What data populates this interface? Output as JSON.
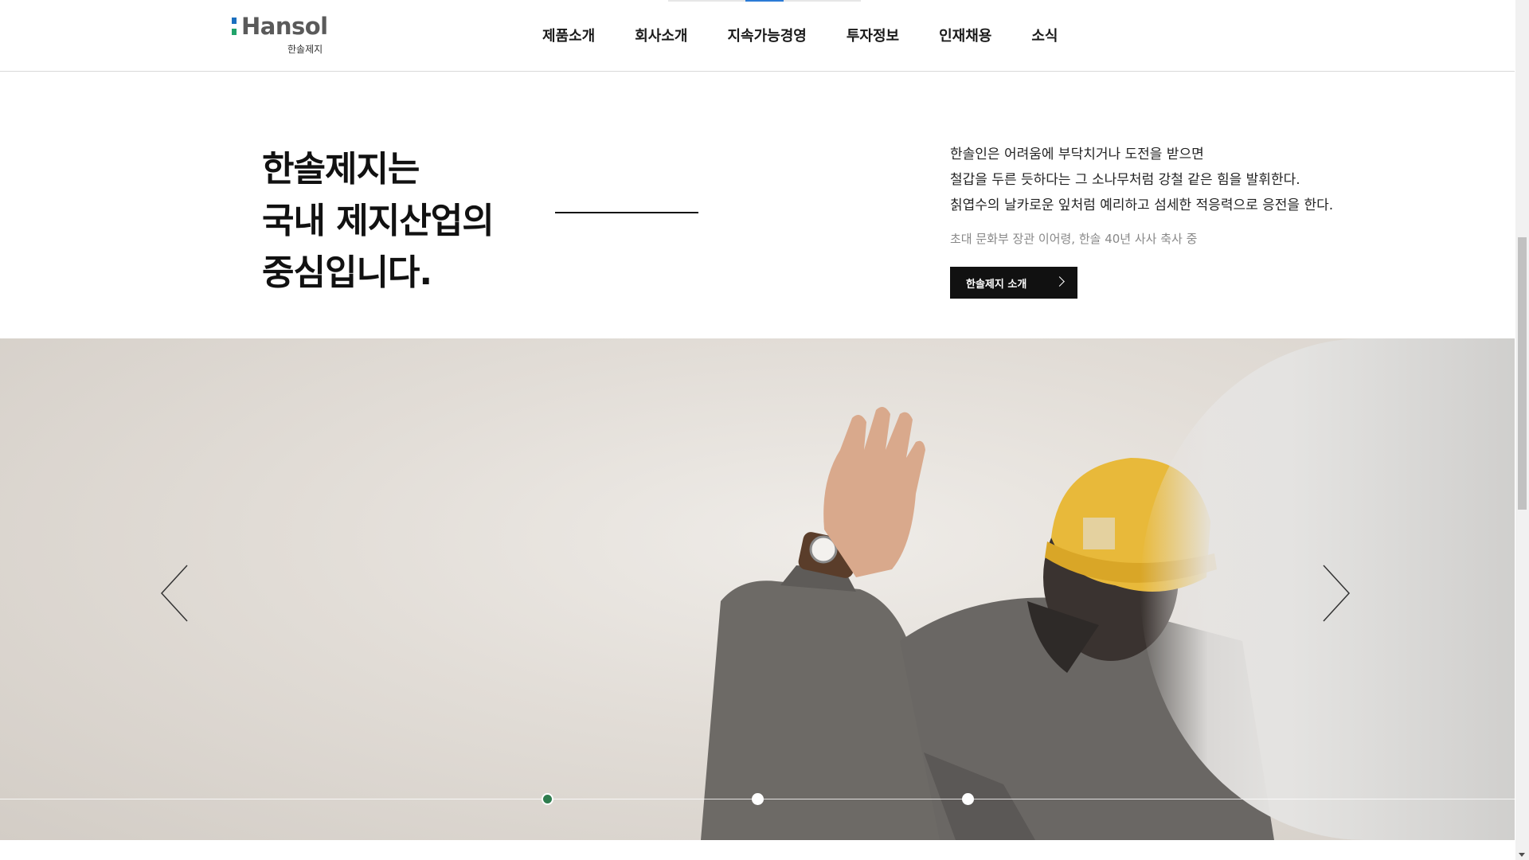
{
  "brand": {
    "name": "Hansol",
    "sub": "한솔제지",
    "colors": {
      "mark_top": "#1b6fbf",
      "mark_bottom": "#21a36a"
    }
  },
  "nav": {
    "items": [
      "제품소개",
      "회사소개",
      "지속가능경영",
      "투자정보",
      "인재채용",
      "소식"
    ]
  },
  "intro": {
    "headline": [
      "한솔제지는",
      "국내 제지산업의",
      "중심입니다."
    ],
    "quote": [
      "한솔인은 어려움에 부닥치거나 도전을 받으면",
      "철갑을 두른 듯하다는 그 소나무처럼 강철 같은 힘을 발휘한다.",
      "칡엽수의 날카로운 잎처럼 예리하고 섬세한 적응력으로 응전을 한다."
    ],
    "citation": "초대 문화부 장관 이어령, 한솔 40년 사사 축사 중",
    "cta_label": "한솔제지 소개"
  },
  "hero": {
    "slides_total": 3,
    "active_slide": 1,
    "accent": "#2f7d4f",
    "prev_icon": "chevron-left-icon",
    "next_icon": "chevron-right-icon"
  }
}
